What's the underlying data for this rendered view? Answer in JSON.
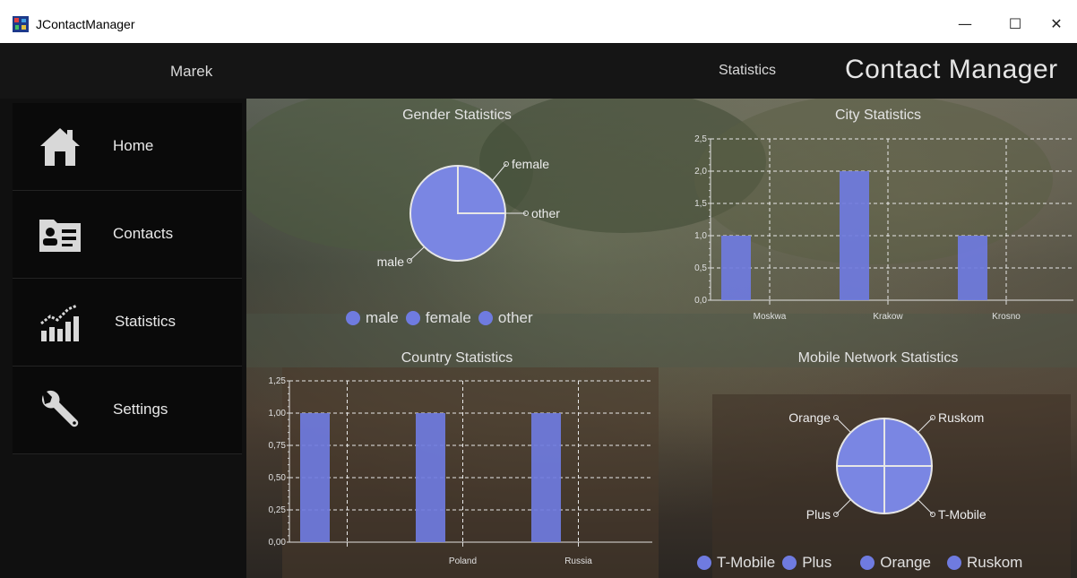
{
  "window": {
    "title": "JContactManager",
    "minimize": "—",
    "maximize": "☐",
    "close": "✕"
  },
  "header": {
    "user": "Marek",
    "section": "Statistics",
    "brand": "Contact Manager"
  },
  "nav": [
    {
      "label": "Home",
      "icon": "home-icon"
    },
    {
      "label": "Contacts",
      "icon": "contacts-icon"
    },
    {
      "label": "Statistics",
      "icon": "chart-icon"
    },
    {
      "label": "Settings",
      "icon": "wrench-icon"
    }
  ],
  "colors": {
    "bar": "#6f7be0",
    "pie": "#7a86e3"
  },
  "chart_data": [
    {
      "type": "pie",
      "title": "Gender Statistics",
      "labels": [
        "female",
        "other",
        "male"
      ],
      "legend": [
        "male",
        "female",
        "other"
      ],
      "values": [
        1,
        0,
        3
      ]
    },
    {
      "type": "bar",
      "title": "City Statistics",
      "categories": [
        "Moskwa",
        "Krakow",
        "Krosno"
      ],
      "values": [
        1.0,
        2.0,
        1.0
      ],
      "ylim": [
        0,
        2.5
      ],
      "yticks": [
        "0,0",
        "0,5",
        "1,0",
        "1,5",
        "2,0",
        "2,5"
      ]
    },
    {
      "type": "bar",
      "title": "Country Statistics",
      "categories": [
        "",
        "Poland",
        "Russia"
      ],
      "values": [
        1.0,
        1.0,
        1.0
      ],
      "ylim": [
        0,
        1.25
      ],
      "yticks": [
        "0,00",
        "0,25",
        "0,50",
        "0,75",
        "1,00",
        "1,25"
      ]
    },
    {
      "type": "pie",
      "title": "Mobile Network Statistics",
      "labels": [
        "Orange",
        "Ruskom",
        "T-Mobile",
        "Plus"
      ],
      "legend": [
        "T-Mobile",
        "Plus",
        "Orange",
        "Ruskom"
      ],
      "values": [
        1,
        1,
        1,
        1
      ]
    }
  ]
}
